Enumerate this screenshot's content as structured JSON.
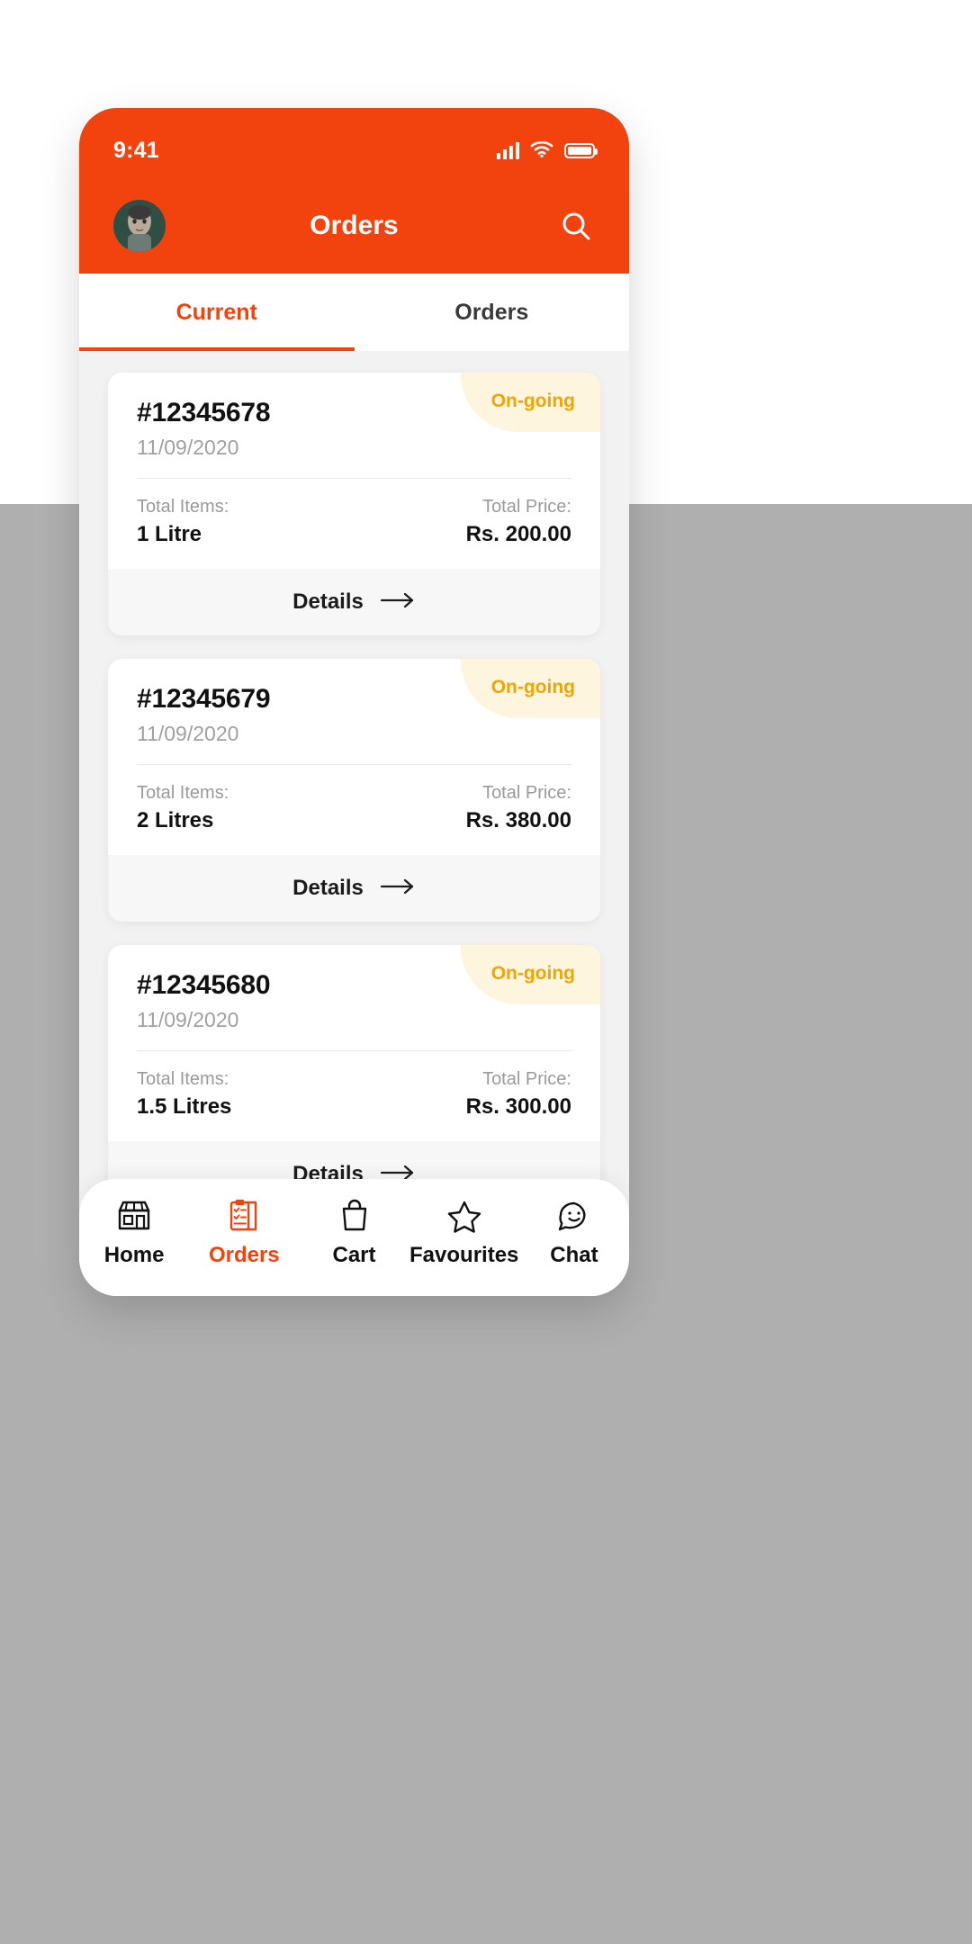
{
  "statusbar": {
    "time": "9:41",
    "signal_icon": "signal-bars-icon",
    "wifi_icon": "wifi-icon",
    "battery_icon": "battery-full-icon"
  },
  "header": {
    "title": "Orders",
    "avatar_name": "user-avatar",
    "search_icon": "search-icon"
  },
  "tabs": [
    {
      "label": "Current",
      "active": true
    },
    {
      "label": "Orders",
      "active": false
    }
  ],
  "orders": [
    {
      "id": "#12345678",
      "date": "11/09/2020",
      "status": "On-going",
      "items_label": "Total Items:",
      "items_value": "1 Litre",
      "price_label": "Total Price:",
      "price_value": "Rs. 200.00",
      "details_label": "Details"
    },
    {
      "id": "#12345679",
      "date": "11/09/2020",
      "status": "On-going",
      "items_label": "Total Items:",
      "items_value": "2 Litres",
      "price_label": "Total Price:",
      "price_value": "Rs. 380.00",
      "details_label": "Details"
    },
    {
      "id": "#12345680",
      "date": "11/09/2020",
      "status": "On-going",
      "items_label": "Total Items:",
      "items_value": "1.5 Litres",
      "price_label": "Total Price:",
      "price_value": "Rs. 300.00",
      "details_label": "Details"
    }
  ],
  "bottomnav": [
    {
      "label": "Home",
      "icon": "storefront-icon",
      "active": false
    },
    {
      "label": "Orders",
      "icon": "clipboard-list-icon",
      "active": true
    },
    {
      "label": "Cart",
      "icon": "shopping-bag-icon",
      "active": false
    },
    {
      "label": "Favourites",
      "icon": "star-icon",
      "active": false
    },
    {
      "label": "Chat",
      "icon": "chat-smiley-icon",
      "active": false
    }
  ],
  "colors": {
    "brand_orange": "#F2430F",
    "badge_bg": "#FDF5DD",
    "badge_text": "#F0A500",
    "content_bg": "#F2F2F2",
    "backdrop_gray": "#AFAFAF"
  }
}
